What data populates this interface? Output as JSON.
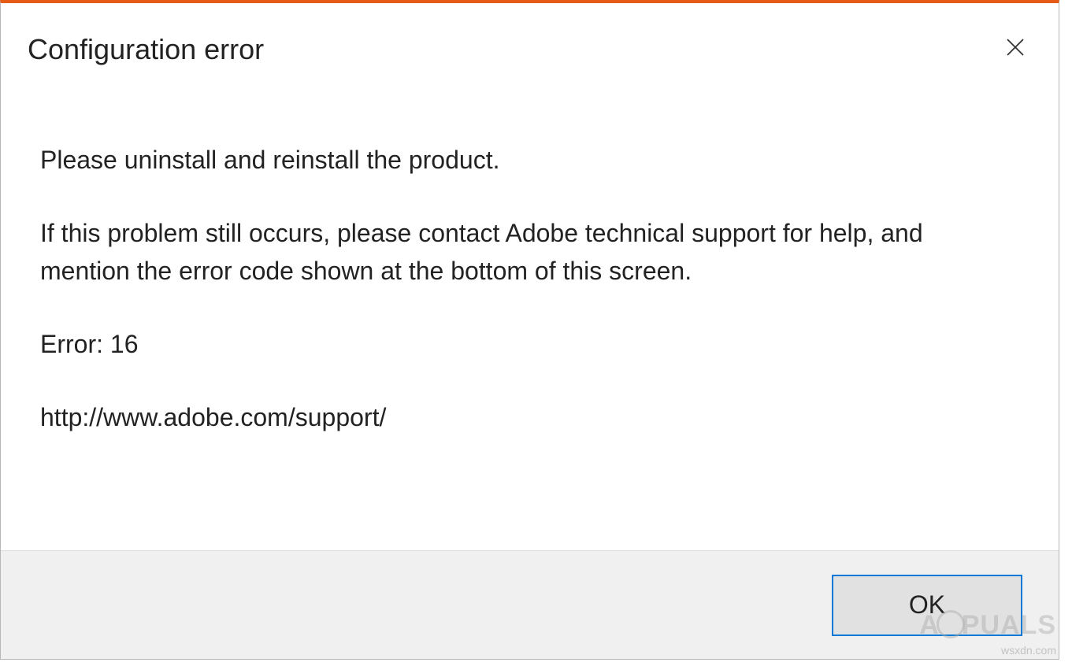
{
  "dialog": {
    "title": "Configuration error",
    "message_line1": "Please uninstall and reinstall the product.",
    "message_line2": "If this problem still occurs, please contact Adobe technical support for help, and mention the error code shown at the bottom of this screen.",
    "error_code": "Error: 16",
    "support_url": "http://www.adobe.com/support/",
    "ok_label": "OK"
  },
  "watermark": {
    "text_left": "A",
    "text_right": "PUALS",
    "sub": "wsxdn.com"
  }
}
